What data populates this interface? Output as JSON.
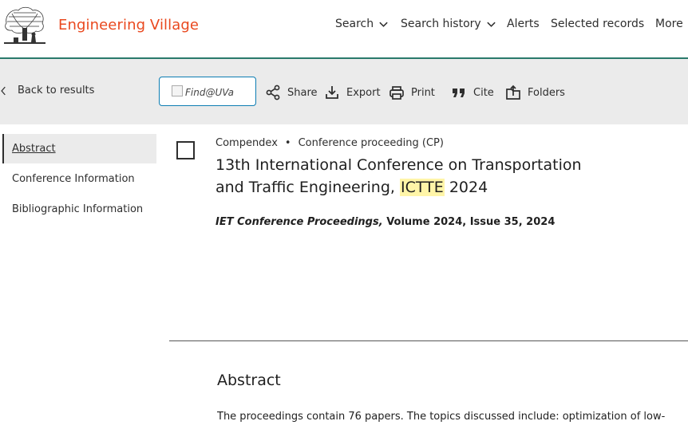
{
  "header": {
    "brand": "Engineering Village",
    "nav": [
      {
        "label": "Search",
        "has_dropdown": true
      },
      {
        "label": "Search history",
        "has_dropdown": true
      },
      {
        "label": "Alerts",
        "has_dropdown": false
      },
      {
        "label": "Selected records",
        "has_dropdown": false
      },
      {
        "label": "More",
        "has_dropdown": true
      }
    ]
  },
  "toolbar": {
    "back_label": "Back to results",
    "findit_alt": "Find@UVa",
    "share_label": "Share",
    "export_label": "Export",
    "print_label": "Print",
    "cite_label": "Cite",
    "folders_label": "Folders"
  },
  "sidebar": {
    "items": [
      {
        "label": "Abstract",
        "active": true
      },
      {
        "label": "Conference Information",
        "active": false
      },
      {
        "label": "Bibliographic Information",
        "active": false
      }
    ]
  },
  "record": {
    "database": "Compendex",
    "doc_type": "Conference proceeding (CP)",
    "title_before": "13th International Conference on Transportation and Traffic Engineering,",
    "title_highlight": "ICTTE",
    "title_after": "2024",
    "journal": "IET Conference Proceedings,",
    "volume_issue": "Volume 2024, Issue 35, 2024"
  },
  "abstract": {
    "heading": "Abstract",
    "text": "The proceedings contain 76 papers. The topics discussed include: optimization of low-"
  },
  "colors": {
    "brand": "#e9481e",
    "header_rule": "#2a7a6b",
    "toolbar_bg": "#ebebeb",
    "highlight": "#fff5a8",
    "findit_border": "#0c7db3"
  },
  "icons": [
    "tree-logo-icon",
    "chevron-down-icon",
    "chevron-left-icon",
    "share-icon",
    "export-icon",
    "print-icon",
    "cite-icon",
    "folders-icon",
    "broken-image-icon"
  ]
}
